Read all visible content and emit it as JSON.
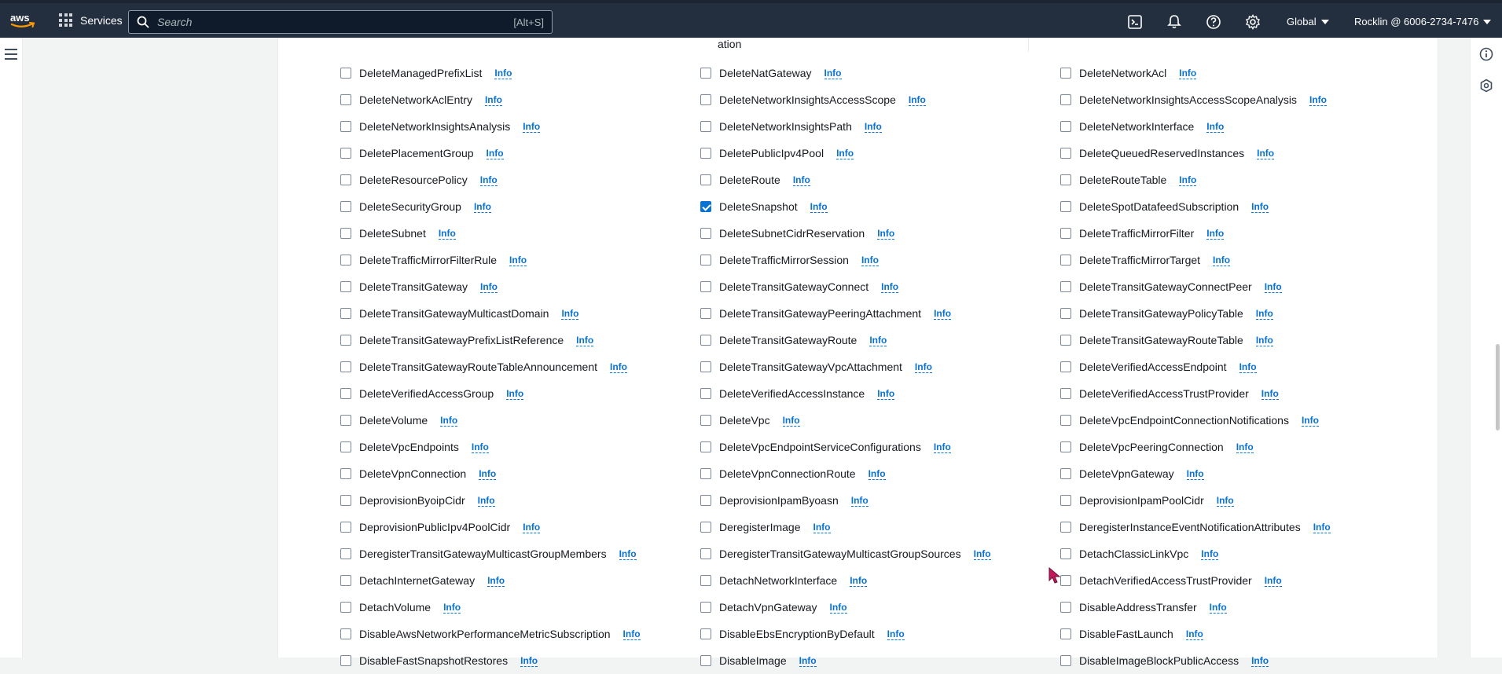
{
  "header": {
    "services_label": "Services",
    "search_placeholder": "Search",
    "search_shortcut": "[Alt+S]",
    "region_label": "Global",
    "account_label": "Rocklin @ 6006-2734-7476"
  },
  "partial_text": "ation",
  "colors": {
    "nav_bg": "#232f3e",
    "accent": "#0972d3",
    "aws_orange": "#ff9900"
  },
  "icons": [
    "aws-logo",
    "grid-icon",
    "search-icon",
    "cloudshell-icon",
    "notifications-icon",
    "help-icon",
    "settings-icon",
    "hamburger-icon",
    "info-panel-icon",
    "tools-icon",
    "cursor-icon"
  ],
  "info_label": "Info",
  "actions": [
    {
      "name": "DeleteManagedPrefixList",
      "checked": false
    },
    {
      "name": "DeleteNatGateway",
      "checked": false
    },
    {
      "name": "DeleteNetworkAcl",
      "checked": false
    },
    {
      "name": "DeleteNetworkAclEntry",
      "checked": false
    },
    {
      "name": "DeleteNetworkInsightsAccessScope",
      "checked": false
    },
    {
      "name": "DeleteNetworkInsightsAccessScopeAnalysis",
      "checked": false
    },
    {
      "name": "DeleteNetworkInsightsAnalysis",
      "checked": false
    },
    {
      "name": "DeleteNetworkInsightsPath",
      "checked": false
    },
    {
      "name": "DeleteNetworkInterface",
      "checked": false
    },
    {
      "name": "DeletePlacementGroup",
      "checked": false
    },
    {
      "name": "DeletePublicIpv4Pool",
      "checked": false
    },
    {
      "name": "DeleteQueuedReservedInstances",
      "checked": false
    },
    {
      "name": "DeleteResourcePolicy",
      "checked": false
    },
    {
      "name": "DeleteRoute",
      "checked": false
    },
    {
      "name": "DeleteRouteTable",
      "checked": false
    },
    {
      "name": "DeleteSecurityGroup",
      "checked": false
    },
    {
      "name": "DeleteSnapshot",
      "checked": true
    },
    {
      "name": "DeleteSpotDatafeedSubscription",
      "checked": false
    },
    {
      "name": "DeleteSubnet",
      "checked": false
    },
    {
      "name": "DeleteSubnetCidrReservation",
      "checked": false
    },
    {
      "name": "DeleteTrafficMirrorFilter",
      "checked": false
    },
    {
      "name": "DeleteTrafficMirrorFilterRule",
      "checked": false
    },
    {
      "name": "DeleteTrafficMirrorSession",
      "checked": false
    },
    {
      "name": "DeleteTrafficMirrorTarget",
      "checked": false
    },
    {
      "name": "DeleteTransitGateway",
      "checked": false
    },
    {
      "name": "DeleteTransitGatewayConnect",
      "checked": false
    },
    {
      "name": "DeleteTransitGatewayConnectPeer",
      "checked": false
    },
    {
      "name": "DeleteTransitGatewayMulticastDomain",
      "checked": false
    },
    {
      "name": "DeleteTransitGatewayPeeringAttachment",
      "checked": false
    },
    {
      "name": "DeleteTransitGatewayPolicyTable",
      "checked": false
    },
    {
      "name": "DeleteTransitGatewayPrefixListReference",
      "checked": false
    },
    {
      "name": "DeleteTransitGatewayRoute",
      "checked": false
    },
    {
      "name": "DeleteTransitGatewayRouteTable",
      "checked": false
    },
    {
      "name": "DeleteTransitGatewayRouteTableAnnouncement",
      "checked": false
    },
    {
      "name": "DeleteTransitGatewayVpcAttachment",
      "checked": false
    },
    {
      "name": "DeleteVerifiedAccessEndpoint",
      "checked": false
    },
    {
      "name": "DeleteVerifiedAccessGroup",
      "checked": false
    },
    {
      "name": "DeleteVerifiedAccessInstance",
      "checked": false
    },
    {
      "name": "DeleteVerifiedAccessTrustProvider",
      "checked": false
    },
    {
      "name": "DeleteVolume",
      "checked": false
    },
    {
      "name": "DeleteVpc",
      "checked": false
    },
    {
      "name": "DeleteVpcEndpointConnectionNotifications",
      "checked": false
    },
    {
      "name": "DeleteVpcEndpoints",
      "checked": false
    },
    {
      "name": "DeleteVpcEndpointServiceConfigurations",
      "checked": false
    },
    {
      "name": "DeleteVpcPeeringConnection",
      "checked": false
    },
    {
      "name": "DeleteVpnConnection",
      "checked": false
    },
    {
      "name": "DeleteVpnConnectionRoute",
      "checked": false
    },
    {
      "name": "DeleteVpnGateway",
      "checked": false
    },
    {
      "name": "DeprovisionByoipCidr",
      "checked": false
    },
    {
      "name": "DeprovisionIpamByoasn",
      "checked": false
    },
    {
      "name": "DeprovisionIpamPoolCidr",
      "checked": false
    },
    {
      "name": "DeprovisionPublicIpv4PoolCidr",
      "checked": false
    },
    {
      "name": "DeregisterImage",
      "checked": false
    },
    {
      "name": "DeregisterInstanceEventNotificationAttributes",
      "checked": false
    },
    {
      "name": "DeregisterTransitGatewayMulticastGroupMembers",
      "checked": false
    },
    {
      "name": "DeregisterTransitGatewayMulticastGroupSources",
      "checked": false
    },
    {
      "name": "DetachClassicLinkVpc",
      "checked": false
    },
    {
      "name": "DetachInternetGateway",
      "checked": false
    },
    {
      "name": "DetachNetworkInterface",
      "checked": false
    },
    {
      "name": "DetachVerifiedAccessTrustProvider",
      "checked": false
    },
    {
      "name": "DetachVolume",
      "checked": false
    },
    {
      "name": "DetachVpnGateway",
      "checked": false
    },
    {
      "name": "DisableAddressTransfer",
      "checked": false
    },
    {
      "name": "DisableAwsNetworkPerformanceMetricSubscription",
      "checked": false
    },
    {
      "name": "DisableEbsEncryptionByDefault",
      "checked": false
    },
    {
      "name": "DisableFastLaunch",
      "checked": false
    },
    {
      "name": "DisableFastSnapshotRestores",
      "checked": false
    },
    {
      "name": "DisableImage",
      "checked": false
    },
    {
      "name": "DisableImageBlockPublicAccess",
      "checked": false
    }
  ]
}
